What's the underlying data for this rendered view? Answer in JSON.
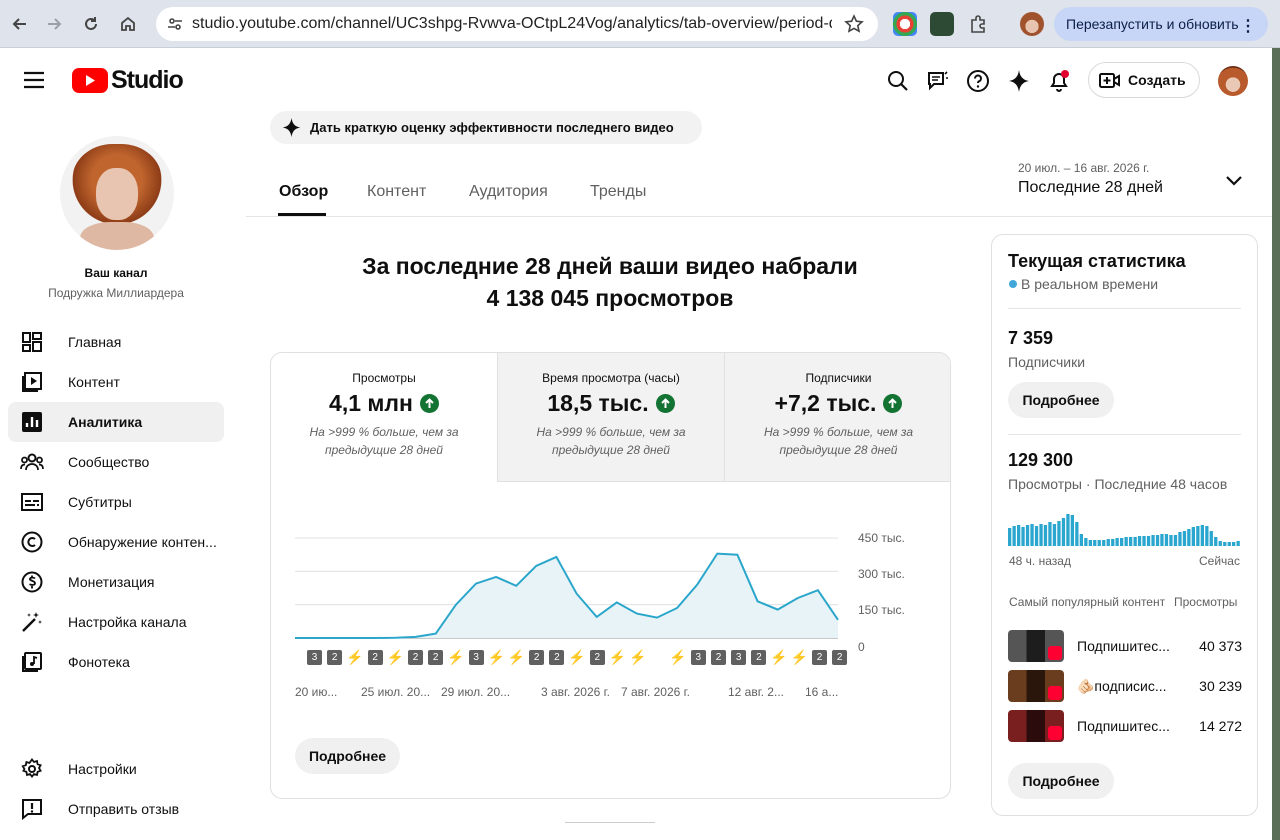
{
  "browser": {
    "url": "studio.youtube.com/channel/UC3shpg-Rvwva-OCtpL24Vog/analytics/tab-overview/period-def...",
    "relaunch_label": "Перезапустить и обновить"
  },
  "header": {
    "logo_text": "Studio",
    "create_label": "Создать"
  },
  "banner": {
    "text": "Дать краткую оценку эффективности последнего видео"
  },
  "channel": {
    "label": "Ваш канал",
    "name": "Подружка Миллиардера"
  },
  "sidebar": {
    "items": [
      {
        "label": "Главная",
        "icon": "dashboard-icon"
      },
      {
        "label": "Контент",
        "icon": "content-icon"
      },
      {
        "label": "Аналитика",
        "icon": "analytics-icon",
        "active": true
      },
      {
        "label": "Сообщество",
        "icon": "community-icon"
      },
      {
        "label": "Субтитры",
        "icon": "subtitles-icon"
      },
      {
        "label": "Обнаружение контен...",
        "icon": "copyright-icon"
      },
      {
        "label": "Монетизация",
        "icon": "monetization-icon"
      },
      {
        "label": "Настройка канала",
        "icon": "customization-icon"
      },
      {
        "label": "Фонотека",
        "icon": "audio-library-icon"
      }
    ],
    "settings_label": "Настройки",
    "feedback_label": "Отправить отзыв"
  },
  "tabs": [
    "Обзор",
    "Контент",
    "Аудитория",
    "Тренды"
  ],
  "period": {
    "range": "20 июл. – 16 авг. 2026 г.",
    "label": "Последние 28 дней"
  },
  "summary": {
    "line1": "За последние 28 дней ваши видео набрали",
    "line2": "4 138 045 просмотров"
  },
  "metrics": [
    {
      "label": "Просмотры",
      "value": "4,1 млн",
      "delta": "На >999 % больше, чем за предыдущие 28 дней"
    },
    {
      "label": "Время просмотра (часы)",
      "value": "18,5 тыс.",
      "delta": "На >999 % больше, чем за предыдущие 28 дней"
    },
    {
      "label": "Подписчики",
      "value": "+7,2 тыс.",
      "delta": "На >999 % больше, чем за предыдущие 28 дней"
    }
  ],
  "chart_data": {
    "type": "area",
    "x": [
      "20 июл.",
      "21 июл.",
      "22 июл.",
      "23 июл.",
      "24 июл.",
      "25 июл.",
      "26 июл.",
      "27 июл.",
      "28 июл.",
      "29 июл.",
      "30 июл.",
      "31 июл.",
      "1 авг.",
      "2 авг.",
      "3 авг.",
      "4 авг.",
      "5 авг.",
      "6 авг.",
      "7 авг.",
      "8 авг.",
      "9 авг.",
      "10 авг.",
      "11 авг.",
      "12 авг.",
      "13 авг.",
      "14 авг.",
      "15 авг.",
      "16 авг."
    ],
    "values": [
      0,
      0,
      0,
      0,
      0,
      1000,
      5000,
      20000,
      150000,
      245000,
      275000,
      235000,
      325000,
      365000,
      200000,
      95000,
      160000,
      110000,
      92000,
      135000,
      240000,
      380000,
      375000,
      165000,
      128000,
      180000,
      215000,
      82000
    ],
    "x_tick_labels": [
      "20 ию...",
      "25 июл. 20...",
      "29 июл. 20...",
      "3 авг. 2026 г.",
      "7 авг. 2026 г.",
      "12 авг. 2...",
      "16 а..."
    ],
    "y_tick_labels": [
      "450 тыс.",
      "300 тыс.",
      "150 тыс.",
      "0"
    ],
    "ylim": [
      0,
      450000
    ],
    "grid": true,
    "color": "#2ba6cb",
    "fill": "#e8f3f7",
    "publish_markers": [
      "3",
      "2",
      "s",
      "2",
      "s",
      "2",
      "2",
      "s",
      "3",
      "s",
      "s",
      "2",
      "2",
      "s",
      "2",
      "s",
      "s",
      "",
      "s",
      "3",
      "2",
      "3",
      "2",
      "s",
      "s",
      "2",
      "2"
    ]
  },
  "more_label": "Подробнее",
  "realtime": {
    "title": "Текущая статистика",
    "live": "В реальном времени",
    "subs_value": "7 359",
    "subs_label": "Подписчики",
    "more1": "Подробнее",
    "views_value": "129 300",
    "views_label": "Просмотры · Последние 48 часов",
    "spark_start": "48 ч. назад",
    "spark_end": "Сейчас",
    "spark_values": [
      18,
      20,
      21,
      19,
      21,
      22,
      20,
      22,
      21,
      24,
      22,
      25,
      28,
      32,
      31,
      24,
      12,
      8,
      6,
      6,
      6,
      6,
      7,
      7,
      8,
      8,
      9,
      9,
      9,
      10,
      10,
      10,
      11,
      11,
      12,
      12,
      11,
      11,
      14,
      15,
      17,
      19,
      20,
      21,
      20,
      15,
      9,
      5,
      4,
      4,
      4,
      5
    ],
    "top_header": "Самый популярный контент",
    "top_col": "Просмотры",
    "top_rows": [
      {
        "title": "Подпишитес...",
        "views": "40 373"
      },
      {
        "title": "🫵🏻подписис...",
        "views": "30 239"
      },
      {
        "title": "Подпишитес...",
        "views": "14 272"
      }
    ],
    "more2": "Подробнее"
  }
}
